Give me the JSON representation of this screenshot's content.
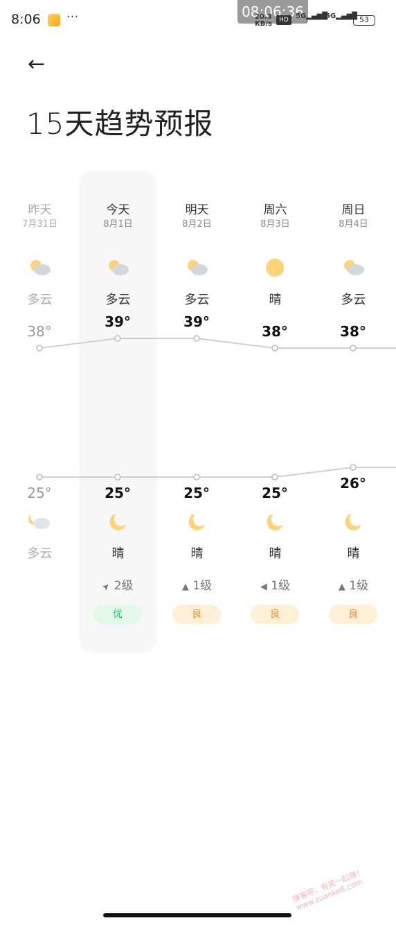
{
  "status_bar": {
    "time": "8:06",
    "more": "···",
    "overlay_time": "08:06:36",
    "net_speed": "20.3",
    "net_unit": "KB/s",
    "hd": "HD",
    "sig1": "5G",
    "sig2": "5G",
    "battery": "53"
  },
  "header": {
    "back_icon": "arrow-left-icon",
    "title": "15天趋势预报"
  },
  "days": [
    {
      "day": "昨天",
      "date": "7月31日",
      "day_icon": "partly-cloudy",
      "day_cond": "多云",
      "high": "38°",
      "high_val": 38,
      "low": "25°",
      "low_val": 25,
      "night_icon": "partly-cloudy-night",
      "night_cond": "多云",
      "wind": "",
      "aqi": "",
      "past": true
    },
    {
      "day": "今天",
      "date": "8月1日",
      "day_icon": "partly-cloudy",
      "day_cond": "多云",
      "high": "39°",
      "high_val": 39,
      "low": "25°",
      "low_val": 25,
      "night_icon": "moon",
      "night_cond": "晴",
      "wind_dir": "northeast",
      "wind": "2级",
      "aqi": "优",
      "aqi_color": "#2dbb6f",
      "aqi_bg": "#e3f7ea"
    },
    {
      "day": "明天",
      "date": "8月2日",
      "day_icon": "partly-cloudy",
      "day_cond": "多云",
      "high": "39°",
      "high_val": 39,
      "low": "25°",
      "low_val": 25,
      "night_icon": "moon",
      "night_cond": "晴",
      "wind_dir": "north",
      "wind": "1级",
      "aqi": "良",
      "aqi_color": "#e88a3c",
      "aqi_bg": "#fdf0d6"
    },
    {
      "day": "周六",
      "date": "8月3日",
      "day_icon": "sunny",
      "day_cond": "晴",
      "high": "38°",
      "high_val": 38,
      "low": "25°",
      "low_val": 25,
      "night_icon": "moon",
      "night_cond": "晴",
      "wind_dir": "west",
      "wind": "1级",
      "aqi": "良",
      "aqi_color": "#e88a3c",
      "aqi_bg": "#fdf0d6"
    },
    {
      "day": "周日",
      "date": "8月4日",
      "day_icon": "partly-cloudy",
      "day_cond": "多云",
      "high": "38°",
      "high_val": 38,
      "low": "26°",
      "low_val": 26,
      "night_icon": "moon",
      "night_cond": "晴",
      "wind_dir": "north",
      "wind": "1级",
      "aqi": "良",
      "aqi_color": "#e88a3c",
      "aqi_bg": "#fdf0d6"
    }
  ],
  "watermark": "赚客吧，有奖一起赚！ www.zuanke8.com"
}
